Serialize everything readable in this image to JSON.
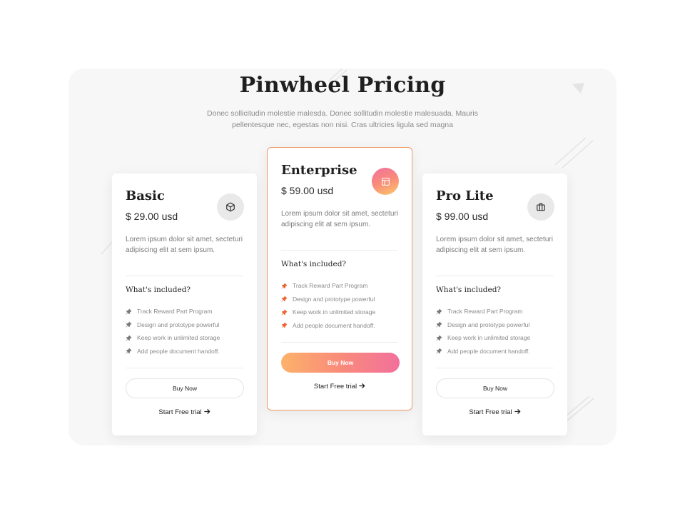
{
  "page": {
    "title": "Pinwheel Pricing",
    "subtitle": "Donec sollicitudin molestie malesda. Donec sollitudin molestie malesuada. Mauris pellentesque nec, egestas non nisi. Cras ultricies ligula sed magna"
  },
  "colors": {
    "panel_bg": "#f7f7f7",
    "accent_gradient_start": "#fcb26a",
    "accent_gradient_end": "#f2709c",
    "pin_highlight": "#f0602e",
    "pin_default": "#777777",
    "enterprise_border": "#f29a6a"
  },
  "plans": [
    {
      "name": "Basic",
      "price": "$ 29.00 usd",
      "icon": "cube-icon",
      "description": "Lorem ipsum dolor sit amet, secteturi adipiscing elit at sem ipsum.",
      "included_title": "What's included?",
      "features": [
        "Track Reward Part Program",
        "Design and prototype powerful",
        "Keep work in unlimited storage",
        "Add people document handoff."
      ],
      "buy_label": "Buy Now",
      "trial_label": "Start Free trial"
    },
    {
      "name": "Enterprise",
      "price": "$ 59.00 usd",
      "icon": "layout-icon",
      "description": "Lorem ipsum dolor sit amet, secteturi adipiscing elit at sem ipsum.",
      "included_title": "What's included?",
      "features": [
        "Track Reward Part Program",
        "Design and prototype powerful",
        "Keep work in unlimited storage",
        "Add people document handoff."
      ],
      "buy_label": "Buy Now",
      "trial_label": "Start Free trial"
    },
    {
      "name": "Pro Lite",
      "price": "$ 99.00 usd",
      "icon": "briefcase-icon",
      "description": "Lorem ipsum dolor sit amet, secteturi adipiscing elit at sem ipsum.",
      "included_title": "What's included?",
      "features": [
        "Track Reward Part Program",
        "Design and prototype powerful",
        "Keep work in unlimited storage",
        "Add people document handoff."
      ],
      "buy_label": "Buy Now",
      "trial_label": "Start Free trial"
    }
  ]
}
